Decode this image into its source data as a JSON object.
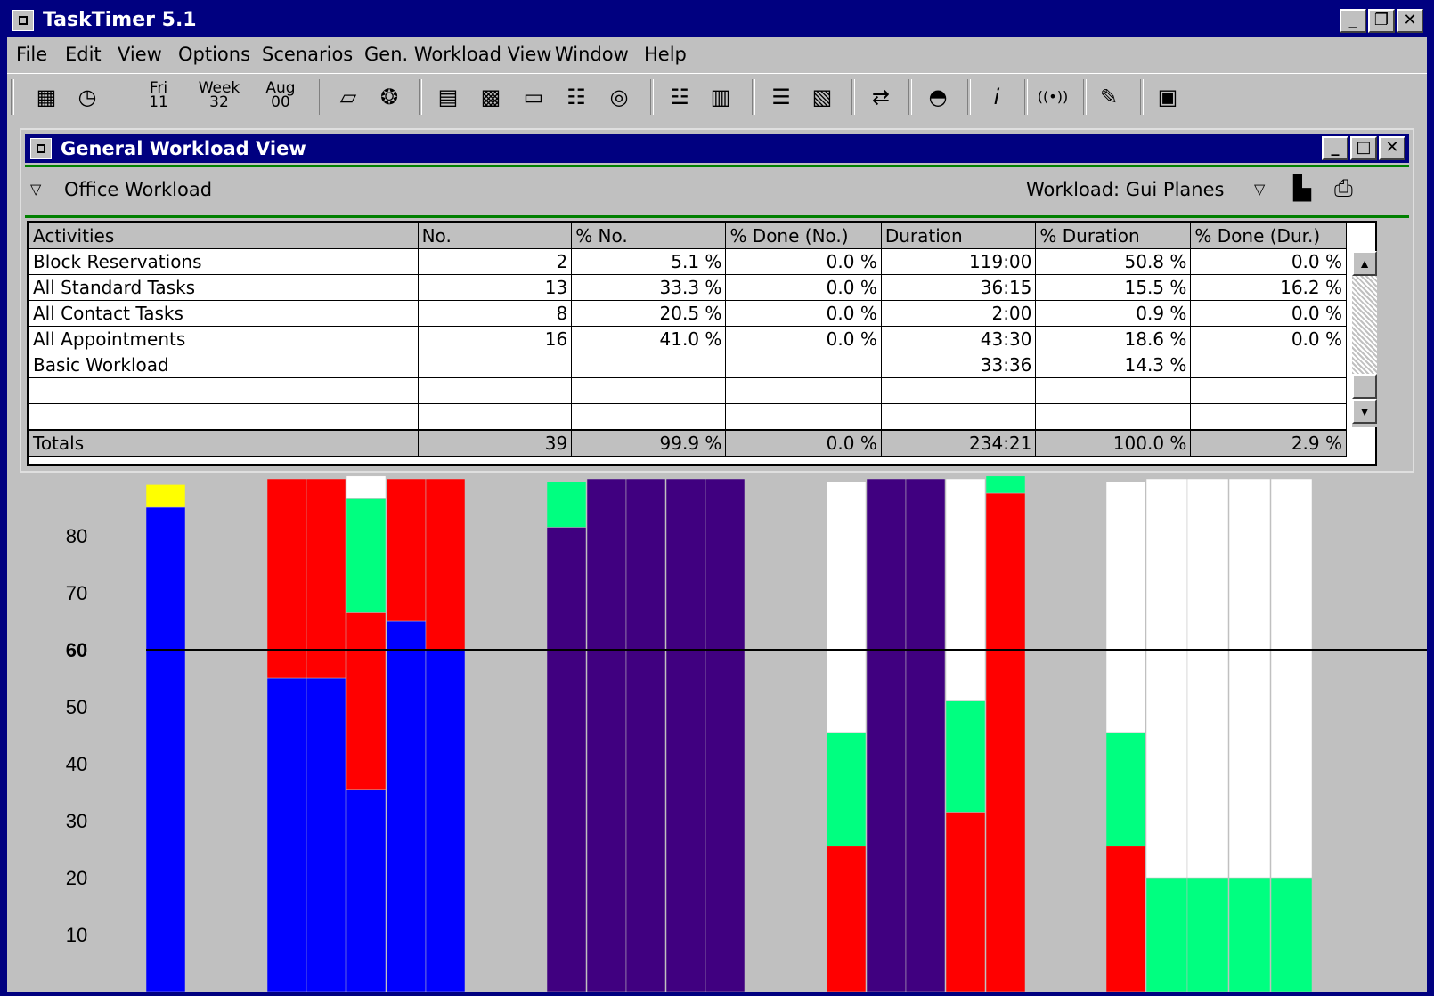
{
  "app": {
    "title": "TaskTimer 5.1",
    "window_buttons": [
      "_",
      "❐",
      "✕"
    ]
  },
  "menu": [
    {
      "label": "File"
    },
    {
      "label": "Edit"
    },
    {
      "label": "View"
    },
    {
      "label": "Options"
    },
    {
      "label": "Scenarios"
    },
    {
      "label": "Gen. Workload View"
    },
    {
      "label": "Window"
    },
    {
      "label": "Help"
    }
  ],
  "toolbar": {
    "day_top": "Fri",
    "day_bottom": "11",
    "week_top": "Week",
    "week_bottom": "32",
    "month_top": "Aug",
    "month_bottom": "00",
    "icons": [
      "calendar-icon",
      "clock-icon",
      "eraser-icon",
      "palette-icon",
      "columns-icon",
      "spreadsheet-icon",
      "computer-icon",
      "tree-icon",
      "target-icon",
      "org-icon",
      "bar-chart-icon",
      "stack-icon",
      "notes-icon",
      "arrows-icon",
      "hat-icon",
      "info-icon",
      "broadcast-icon",
      "draw-icon",
      "window-icon"
    ]
  },
  "child_window": {
    "title": "General Workload View",
    "filter_label": "Office Workload",
    "workload_label": "Workload: Gui Planes"
  },
  "table": {
    "headers": [
      "Activities",
      "No.",
      "% No.",
      "% Done (No.)",
      "Duration",
      "% Duration",
      "% Done (Dur.)"
    ],
    "rows": [
      [
        "Block Reservations",
        "2",
        "5.1 %",
        "0.0 %",
        "119:00",
        "50.8 %",
        "0.0 %"
      ],
      [
        "All Standard Tasks",
        "13",
        "33.3 %",
        "0.0 %",
        "36:15",
        "15.5 %",
        "16.2 %"
      ],
      [
        "All Contact Tasks",
        "8",
        "20.5 %",
        "0.0 %",
        "2:00",
        "0.9 %",
        "0.0 %"
      ],
      [
        "All Appointments",
        "16",
        "41.0 %",
        "0.0 %",
        "43:30",
        "18.6 %",
        "0.0 %"
      ],
      [
        "Basic Workload",
        "",
        "",
        "",
        "33:36",
        "14.3 %",
        ""
      ],
      [
        "",
        "",
        "",
        "",
        "",
        "",
        ""
      ],
      [
        "",
        "",
        "",
        "",
        "",
        "",
        ""
      ]
    ],
    "totals": [
      "Totals",
      "39",
      "99.9 %",
      "0.0 %",
      "234:21",
      "100.0 %",
      "2.9 %"
    ]
  },
  "chart_data": {
    "type": "bar",
    "stacked": true,
    "yticks": [
      "10",
      "20",
      "30",
      "40",
      "50",
      "60",
      "70",
      "80"
    ],
    "reference_line": 60,
    "ylim": [
      0,
      87
    ],
    "colors": {
      "blue": "#0000ff",
      "red": "#ff0000",
      "green": "#00ff80",
      "white": "#ffffff",
      "purple": "#400080",
      "yellow": "#ffff00"
    },
    "bars": [
      {
        "segments": [
          [
            "blue",
            85
          ],
          [
            "yellow",
            4
          ]
        ]
      },
      {
        "segments": [
          [
            "blue",
            55
          ],
          [
            "red",
            35
          ]
        ]
      },
      {
        "segments": [
          [
            "blue",
            55
          ],
          [
            "red",
            35
          ]
        ]
      },
      {
        "segments": [
          [
            "blue",
            35.5
          ],
          [
            "red",
            31
          ],
          [
            "green",
            20
          ],
          [
            "white",
            4
          ]
        ]
      },
      {
        "segments": [
          [
            "blue",
            65
          ],
          [
            "red",
            25
          ]
        ]
      },
      {
        "segments": [
          [
            "blue",
            60
          ],
          [
            "red",
            30
          ]
        ]
      },
      {
        "segments": [
          [
            "purple",
            81.5
          ],
          [
            "green",
            8
          ]
        ]
      },
      {
        "segments": [
          [
            "purple",
            90
          ]
        ]
      },
      {
        "segments": [
          [
            "purple",
            90
          ]
        ]
      },
      {
        "segments": [
          [
            "purple",
            90
          ]
        ]
      },
      {
        "segments": [
          [
            "purple",
            90
          ]
        ]
      },
      {
        "segments": [
          [
            "red",
            25.5
          ],
          [
            "green",
            20
          ],
          [
            "white",
            44
          ]
        ]
      },
      {
        "segments": [
          [
            "purple",
            90
          ]
        ]
      },
      {
        "segments": [
          [
            "purple",
            90
          ]
        ]
      },
      {
        "segments": [
          [
            "red",
            31.5
          ],
          [
            "green",
            19.5
          ],
          [
            "white",
            39
          ]
        ]
      },
      {
        "segments": [
          [
            "red",
            87.5
          ],
          [
            "green",
            3
          ]
        ]
      },
      {
        "segments": [
          [
            "red",
            25.5
          ],
          [
            "green",
            20
          ],
          [
            "white",
            44
          ]
        ]
      },
      {
        "segments": [
          [
            "green",
            20
          ],
          [
            "white",
            70
          ]
        ]
      },
      {
        "segments": [
          [
            "green",
            20
          ],
          [
            "white",
            70
          ]
        ]
      },
      {
        "segments": [
          [
            "green",
            20
          ],
          [
            "white",
            70
          ]
        ]
      },
      {
        "segments": [
          [
            "green",
            20
          ],
          [
            "white",
            70
          ]
        ]
      }
    ]
  }
}
